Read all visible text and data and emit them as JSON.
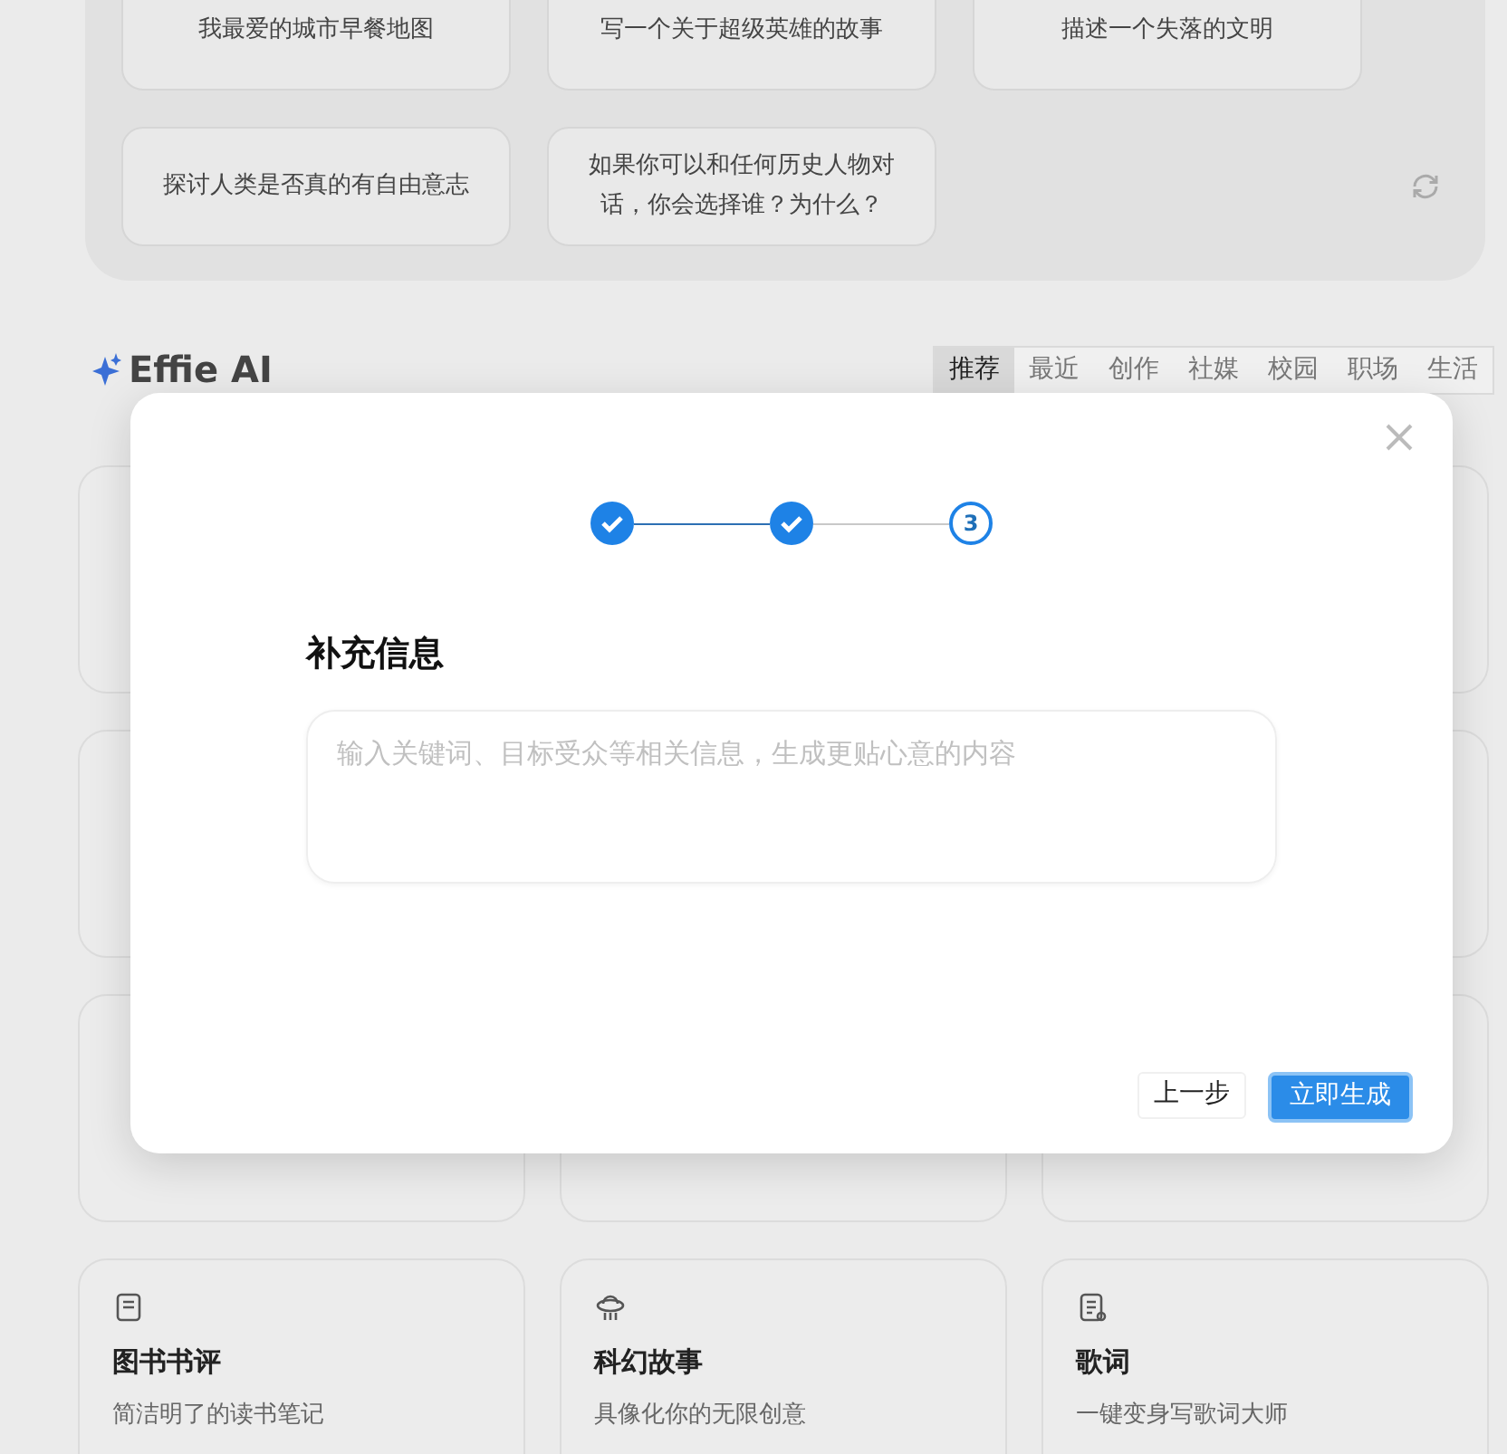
{
  "prompts": [
    {
      "text": "我最爱的城市早餐地图"
    },
    {
      "text": "写一个关于超级英雄的故事"
    },
    {
      "text": "描述一个失落的文明"
    },
    {
      "text": "探讨人类是否真的有自由意志"
    },
    {
      "text": "如果你可以和任何历史人物对话，你会选择谁？为什么？"
    }
  ],
  "brand": "Effie AI",
  "tabs": [
    {
      "label": "推荐",
      "selected": true
    },
    {
      "label": "最近",
      "selected": false
    },
    {
      "label": "创作",
      "selected": false
    },
    {
      "label": "社媒",
      "selected": false
    },
    {
      "label": "校园",
      "selected": false
    },
    {
      "label": "职场",
      "selected": false
    },
    {
      "label": "生活",
      "selected": false
    }
  ],
  "cards": [
    {
      "title": "图书书评",
      "desc_lines": [
        "简洁明了的读书笔记"
      ]
    },
    {
      "title": "科幻故事",
      "desc_lines": [
        "具像化你的无限创意"
      ]
    },
    {
      "title": "歌词",
      "desc_lines": [
        "一键变身写歌词大师"
      ]
    }
  ],
  "dialog": {
    "steps": [
      {
        "done": true
      },
      {
        "done": true
      },
      {
        "done": false,
        "label": "3"
      }
    ],
    "title": "补充信息",
    "input": {
      "placeholder": "输入关键词、目标受众等相关信息，生成更贴心意的内容"
    },
    "buttons": [
      {
        "label": "上一步",
        "kind": "secondary"
      },
      {
        "label": "立即生成",
        "kind": "primary"
      }
    ]
  }
}
